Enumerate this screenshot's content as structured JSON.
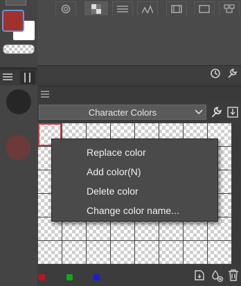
{
  "color_set_panel": {
    "selected_set": "Character Colors"
  },
  "context_menu": {
    "items": [
      {
        "label": "Replace color"
      },
      {
        "label": "Add color(N)"
      },
      {
        "label": "Delete color"
      },
      {
        "label": "Change color name..."
      }
    ]
  },
  "colors": {
    "main_color": "#a0322b",
    "sub_color": "#ffffff",
    "menu_bg": "#4a4a4a",
    "selected_border": "#c63b3b",
    "bottom_swatches": [
      "#c0141c",
      "#15a319",
      "#1a1adb"
    ]
  },
  "icons": {
    "pen_tool": "pen-icon",
    "tool_property": "sliders-icon",
    "settings": "wrench-icon",
    "timer": "clock-icon",
    "eyedropper": "eyedropper-icon",
    "import": "import-icon",
    "add_set": "add-color-icon",
    "delete": "trash-icon"
  }
}
